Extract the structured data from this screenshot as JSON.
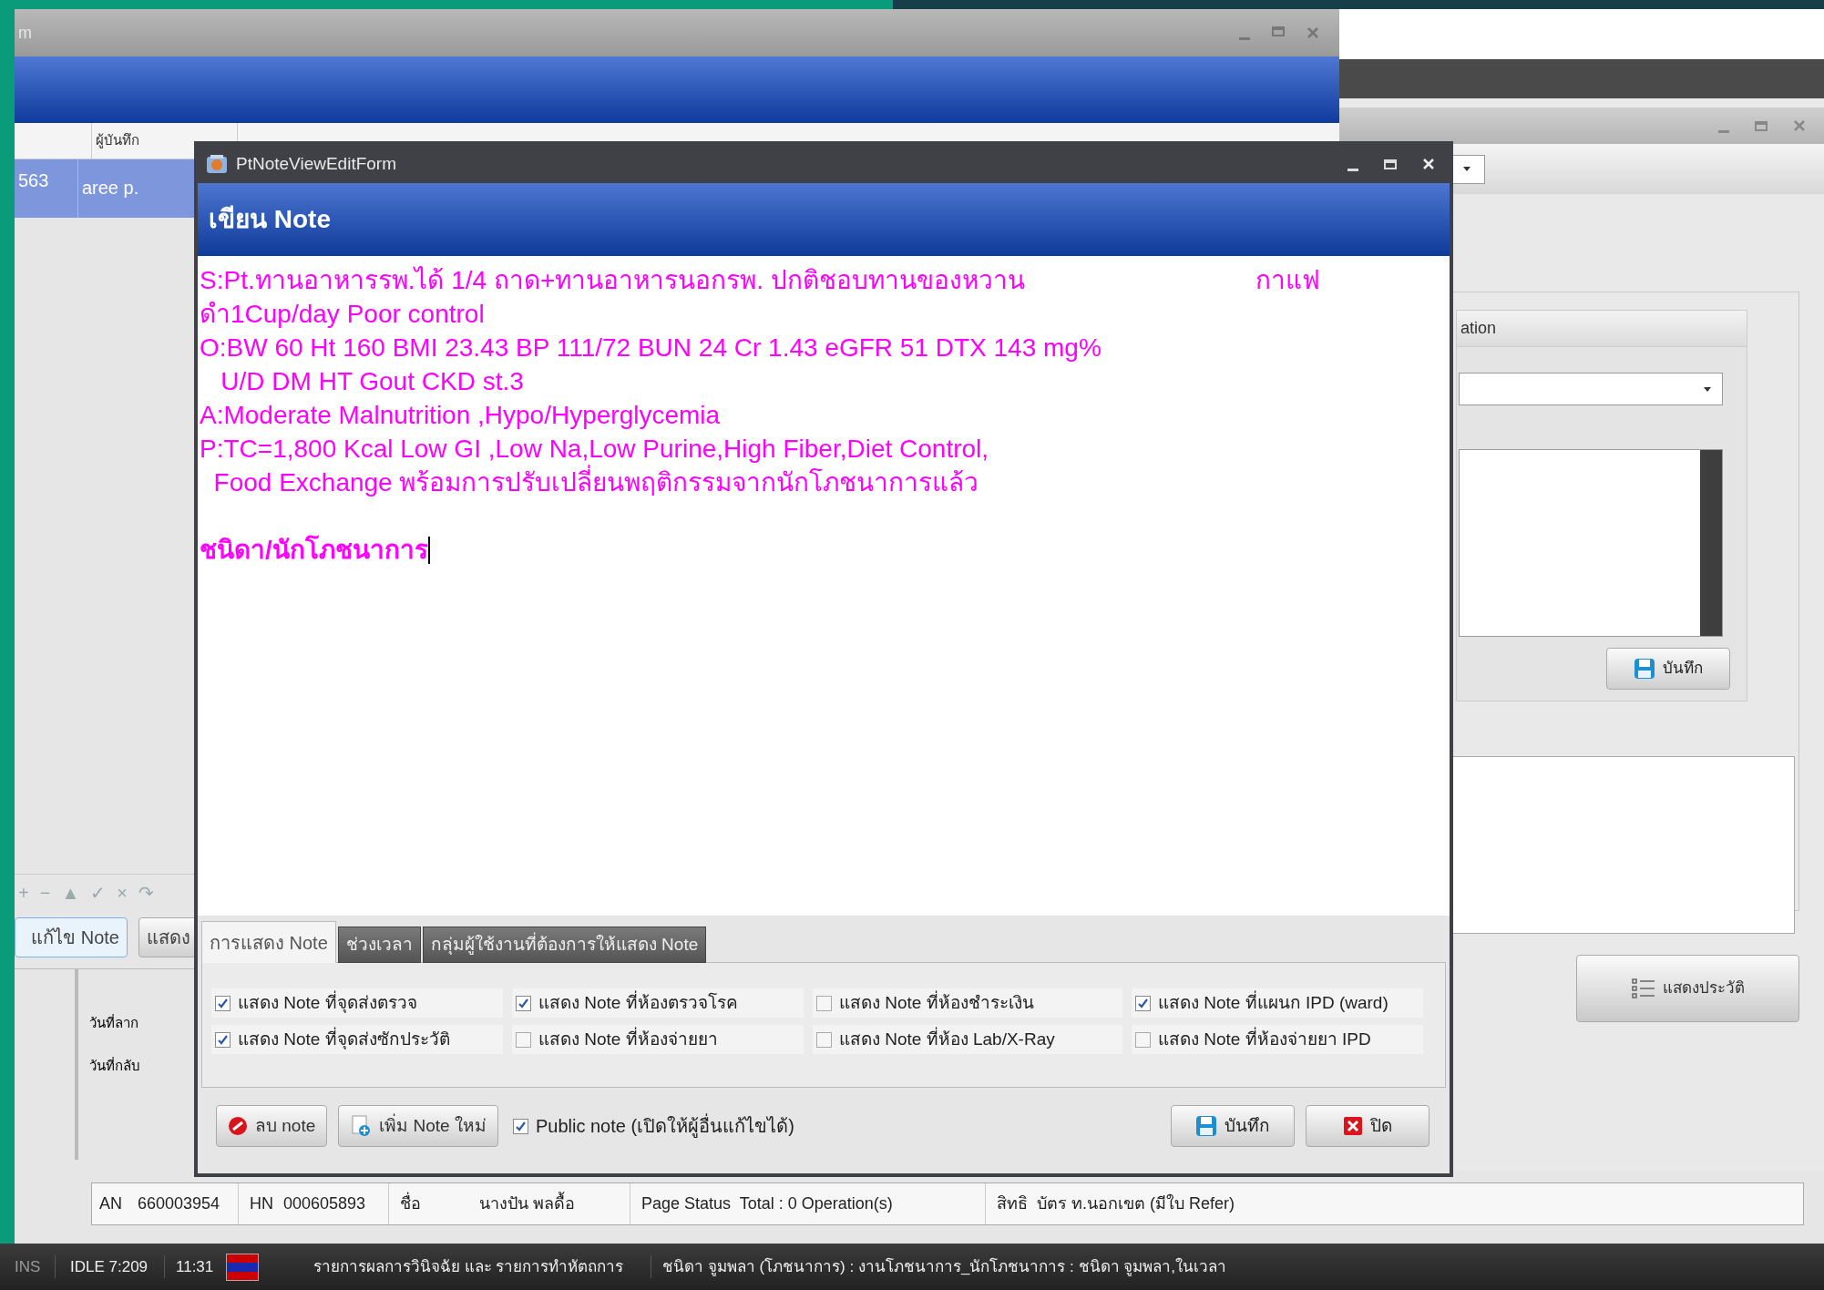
{
  "back_window": {
    "title": "m",
    "table": {
      "columns": [
        "",
        "ผู้บันทึก"
      ],
      "rows": [
        {
          "cells": [
            "563",
            "aree p."
          ],
          "selected": true
        }
      ]
    },
    "toolbar": [
      "+",
      "−",
      "▲",
      "✓",
      "×",
      "↷"
    ],
    "buttons": [
      "แก้ไข Note",
      "แสดง"
    ],
    "labels": [
      "วันที่ลาก",
      "วันที่กลับ"
    ],
    "info_row": [
      "AN",
      "660003954",
      "HN",
      "000605893",
      "ชื่อ",
      "นางปัน พลดื้อ",
      "Page Status  Total : 0 Operation(s)",
      "สิทธิ  บัตร ท.นอกเขต (มีใบ Refer)"
    ]
  },
  "right_window": {
    "group_title": "ation",
    "save_button": "บันทึก",
    "history_button": "แสดงประวัติ"
  },
  "dialog": {
    "title": "PtNoteViewEditForm",
    "header": "เขียน Note",
    "note_lines": [
      {
        "text": "S:Pt.ทานอาหารรพ.ได้ 1/4 ถาด+ทานอาหารนอกรพ. ปกติชอบทานของหวาน",
        "aside": "กาแฟ"
      },
      {
        "text": "ดำ1Cup/day Poor control"
      },
      {
        "text": "O:BW 60 Ht 160 BMI 23.43 BP 111/72 BUN 24 Cr 1.43 eGFR 51 DTX 143 mg%"
      },
      {
        "text": "   U/D DM HT Gout CKD st.3"
      },
      {
        "text": "A:Moderate Malnutrition ,Hypo/Hyperglycemia"
      },
      {
        "text": "P:TC=1,800 Kcal Low GI ,Low Na,Low Purine,High Fiber,Diet Control,"
      },
      {
        "text": "  Food Exchange พร้อมการปรับเปลี่ยนพฤติกรรมจากนักโภชนาการแล้ว"
      },
      {
        "text": "ชนิดา/นักโภชนาการ",
        "bold": true
      }
    ],
    "tabs": [
      {
        "label": "การแสดง Note",
        "selected": true
      },
      {
        "label": "ช่วงเวลา",
        "selected": false
      },
      {
        "label": "กลุ่มผู้ใช้งานที่ต้องการให้แสดง Note",
        "selected": false
      }
    ],
    "options": [
      {
        "label": "แสดง Note ที่จุดส่งตรวจ",
        "checked": true
      },
      {
        "label": "แสดง Note ที่ห้องตรวจโรค",
        "checked": true
      },
      {
        "label": "แสดง Note ที่ห้องชำระเงิน",
        "checked": false
      },
      {
        "label": "แสดง Note ที่แผนก IPD (ward)",
        "checked": true
      },
      {
        "label": "แสดง Note ที่จุดส่งซักประวัติ",
        "checked": true
      },
      {
        "label": "แสดง Note ที่ห้องจ่ายยา",
        "checked": false
      },
      {
        "label": "แสดง Note ที่ห้อง Lab/X-Ray",
        "checked": false
      },
      {
        "label": "แสดง Note ที่ห้องจ่ายยา IPD",
        "checked": false
      }
    ],
    "delete_button": "ลบ note",
    "add_button": "เพิ่ม Note ใหม่",
    "public_note": {
      "label": "Public note (เปิดให้ผู้อื่นแก้ไขได้)",
      "checked": true
    },
    "save_button": "บันทึก",
    "close_button": "ปิด"
  },
  "taskbar": {
    "mode": "INS",
    "idle": "IDLE 7:209",
    "time": "11:31",
    "menu": "รายการผลการวินิจฉัย และ รายการทำหัตถการ",
    "user": "ชนิดา จูมพลา (โภชนาการ) : งานโภชนาการ_นักโภชนาการ : ชนิดา จูมพลา,ในเวลา"
  }
}
